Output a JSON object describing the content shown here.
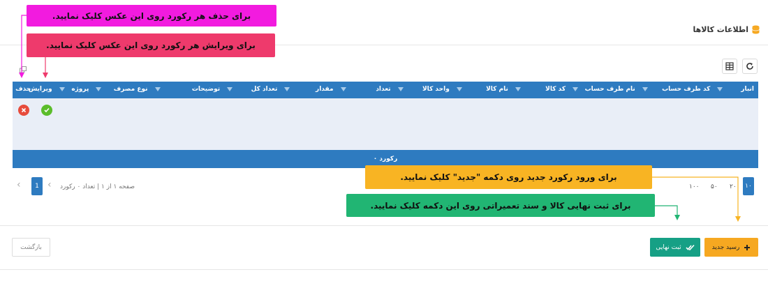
{
  "header": {
    "title": "اطلاعات کالاها"
  },
  "grid": {
    "columns": [
      {
        "key": "anbar",
        "label": "انبار",
        "width": 64
      },
      {
        "key": "code_taraf",
        "label": "کد طرف حساب",
        "width": 110
      },
      {
        "key": "name_taraf",
        "label": "نام طرف حساب",
        "width": 102
      },
      {
        "key": "code_kala",
        "label": "کد کالا",
        "width": 84
      },
      {
        "key": "name_kala",
        "label": "نام کالا",
        "width": 86
      },
      {
        "key": "vahed",
        "label": "واحد کالا",
        "width": 86
      },
      {
        "key": "tedad",
        "label": "تعداد",
        "width": 84
      },
      {
        "key": "meghdar",
        "label": "مقدار",
        "width": 82
      },
      {
        "key": "tedad_kol",
        "label": "تعداد کل",
        "width": 84
      },
      {
        "key": "tozihat",
        "label": "توضیحات",
        "width": 106
      },
      {
        "key": "noe_masraf",
        "label": "نوع مصرف",
        "width": 86
      },
      {
        "key": "prozheh",
        "label": "پروژه",
        "width": 54
      },
      {
        "key": "virayesh",
        "label": "ویرایش",
        "width": 0
      },
      {
        "key": "hazf",
        "label": "حذف",
        "width": 0
      }
    ],
    "footer": "۰ رکورد"
  },
  "pager": {
    "current_page": "1",
    "info": "صفحه ۱ از ۱ | تعداد ۰ رکورد",
    "page_sizes": [
      "۱۰",
      "۲۰",
      "۵۰",
      "۱۰۰"
    ]
  },
  "buttons": {
    "new_receipt": "رسید جدید",
    "final_submit": "ثبت نهایی",
    "back": "بازگشت"
  },
  "callouts": {
    "delete": "برای حذف هر رکورد روی این عکس کلیک نمایید.",
    "edit": "برای ویرایش هر رکورد روی این عکس کلیک نمایید.",
    "new": "برای ورود رکورد جدید روی دکمه \"جدید\" کلیک نمایید.",
    "final": "برای ثبت نهایی کالا و سند تعمیراتی روی این دکمه کلیک نمایید."
  },
  "colors": {
    "header_blue": "#2e7bc0",
    "body_light": "#e9eef7",
    "callout_magenta": "#f21bdf",
    "callout_pink": "#ee3a6c",
    "callout_yellow": "#f8b423",
    "callout_green": "#21b573",
    "btn_new": "#f6a821",
    "btn_final": "#16a085"
  },
  "icons": {
    "title": "database-icon",
    "refresh": "refresh-icon",
    "columns": "columns-icon",
    "export": "export-icon",
    "delete": "delete-icon",
    "edit": "check-icon",
    "add": "plus-icon",
    "final": "double-check-icon"
  }
}
